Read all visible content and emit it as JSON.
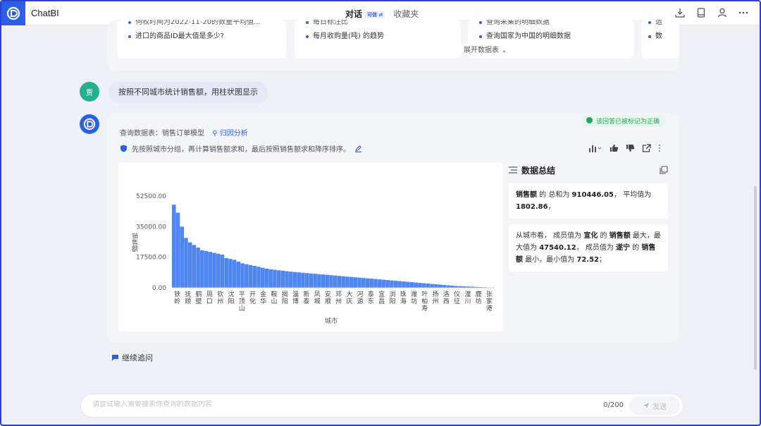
{
  "app": {
    "title": "ChatBI"
  },
  "tabs": [
    {
      "label": "对话",
      "badge": "可信 ⇄"
    },
    {
      "label": "收藏夹"
    }
  ],
  "suggestions": {
    "cards": [
      {
        "items": [
          "何牧时间为2022-11-20的数量平均值...",
          "进口的商品ID最大值是多少?"
        ]
      },
      {
        "items": [
          "每日标注比",
          "每月收购量(吨) 的趋势"
        ]
      },
      {
        "items": [
          "查询采集的明细数据",
          "查询国家为中国的明细数据"
        ]
      },
      {
        "items": [
          "运",
          "数"
        ]
      }
    ],
    "expand_label": "展开数据表"
  },
  "user_message": {
    "avatar_text": "贾",
    "text": "按照不同城市统计销售额，用柱状图显示"
  },
  "bot": {
    "correct_tag": "该回答已被标记为正确",
    "query_prefix": "查询数据表：",
    "query_table": "销售订单模型",
    "attribution_label": "归因分析",
    "description": "先按照城市分组，再计算销售额求和，最后按照销售额求和降序排序。"
  },
  "summary": {
    "title": "数据总结",
    "p1": {
      "metric": "销售额",
      "t1": " 的 总和为 ",
      "total": "910446.05",
      "t2": "，  平均值为 ",
      "avg": "1802.86",
      "t3": "，"
    },
    "p2": {
      "t1": "从城市看，  成员值为 ",
      "city_max": "宣化",
      "t2": " 的 ",
      "metric": "销售额",
      "t3": " 最大，最大值为 ",
      "max": "47540.12",
      "t4": "，  成员值为 ",
      "city_min": "遂宁",
      "t5": " 的 ",
      "metric2": "销售额",
      "t6": " 最小，最小值为 ",
      "min": "72.52",
      "t7": "；"
    }
  },
  "followup_label": "继续追问",
  "input": {
    "placeholder": "请尝试输入需要搜索你查询的数据内容",
    "counter": "0/200",
    "send_label": "发送"
  },
  "colors": {
    "accent": "#2b5fe6",
    "bar": "#4f86f0"
  },
  "chart_data": {
    "type": "bar",
    "ylabel": "销售额",
    "xlabel": "城市",
    "yticks": [
      "52500.00",
      "35000.00",
      "17500.00",
      "0.00"
    ],
    "ytick_values": [
      52500,
      35000,
      17500,
      0
    ],
    "ylim": [
      0,
      52500
    ],
    "bar_count": 60,
    "values": [
      47540,
      43000,
      35000,
      28500,
      26000,
      24500,
      23000,
      21500,
      21000,
      20500,
      20000,
      19500,
      19000,
      17000,
      16500,
      16000,
      15000,
      14000,
      13500,
      13000,
      12500,
      12000,
      11500,
      11000,
      10500,
      10300,
      10000,
      9800,
      9500,
      9200,
      9000,
      8800,
      8600,
      8400,
      8200,
      8000,
      7800,
      7600,
      7400,
      7200,
      7000,
      6800,
      6600,
      6400,
      6200,
      6000,
      5800,
      5600,
      5400,
      5200,
      5000,
      4800,
      4600,
      4400,
      4200,
      4000,
      3800,
      3600,
      3400,
      3200,
      3000,
      2800,
      2600,
      2400,
      2200,
      2000,
      1800,
      1600,
      1400,
      1200,
      1000,
      900,
      800,
      700,
      600,
      500,
      400,
      300,
      200,
      73
    ],
    "x_labels": [
      "铁岭",
      "抚顺",
      "鹤壁",
      "周口",
      "钦州",
      "沈阳",
      "平顶山",
      "开化",
      "金华",
      "鞍山",
      "揭阳",
      "淄博",
      "新泰",
      "凤城",
      "安顺",
      "邓州",
      "大庆",
      "河源",
      "泰东",
      "宜昌",
      "浏阳",
      "珠海",
      "潍坊",
      "叶柏寿",
      "扬州",
      "洛西",
      "仪征",
      "潼川",
      "鹿坊",
      "张家港"
    ]
  }
}
